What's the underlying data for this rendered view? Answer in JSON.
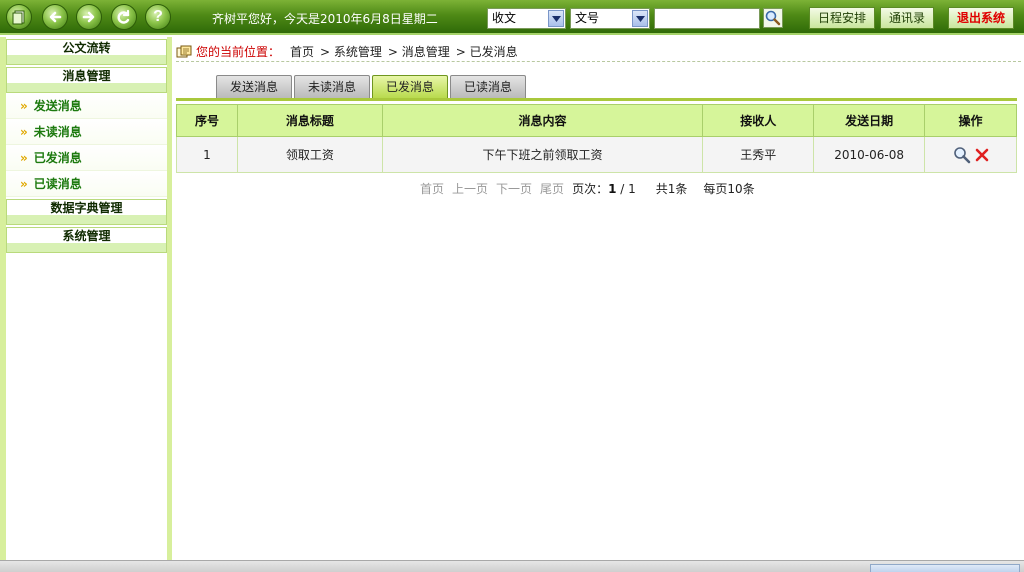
{
  "topbar": {
    "greeting": "齐树平您好，今天是2010年6月8日星期二",
    "nav_icons": [
      "document-icon",
      "back-arrow-icon",
      "forward-arrow-icon",
      "refresh-icon",
      "help-icon"
    ],
    "help_glyph": "?",
    "select1_value": "收文",
    "select2_value": "文号",
    "search_value": "",
    "buttons": {
      "schedule": "日程安排",
      "contacts": "通讯录",
      "logout": "退出系统"
    },
    "colors": {
      "bar": "#4f8a16",
      "logout_text": "#e00000"
    }
  },
  "sidebar": {
    "sections": [
      {
        "label": "公文流转"
      },
      {
        "label": "消息管理"
      },
      {
        "label": "数据字典管理"
      },
      {
        "label": "系统管理"
      }
    ],
    "message_items": [
      {
        "label": "发送消息"
      },
      {
        "label": "未读消息"
      },
      {
        "label": "已发消息"
      },
      {
        "label": "已读消息"
      }
    ],
    "chevron": "»"
  },
  "breadcrumb": {
    "label": "您的当前位置：",
    "items": [
      "首页",
      "> 系统管理",
      "> 消息管理",
      "> 已发消息"
    ]
  },
  "tabs": [
    {
      "label": "发送消息",
      "active": false
    },
    {
      "label": "未读消息",
      "active": false
    },
    {
      "label": "已发消息",
      "active": true
    },
    {
      "label": "已读消息",
      "active": false
    }
  ],
  "table": {
    "columns": [
      "序号",
      "消息标题",
      "消息内容",
      "接收人",
      "发送日期",
      "操作"
    ],
    "rows": [
      {
        "index": "1",
        "title": "领取工资",
        "content": "下午下班之前领取工资",
        "receiver": "王秀平",
        "date": "2010-06-08",
        "actions": [
          "view-icon",
          "delete-icon"
        ]
      }
    ]
  },
  "pager": {
    "first": "首页",
    "prev": "上一页",
    "next": "下一页",
    "last": "尾页",
    "page_label": "页次：",
    "current_page": "1",
    "page_sep": "/",
    "total_pages": "1",
    "total_label": "共1条",
    "per_page_label": "每页10条"
  }
}
